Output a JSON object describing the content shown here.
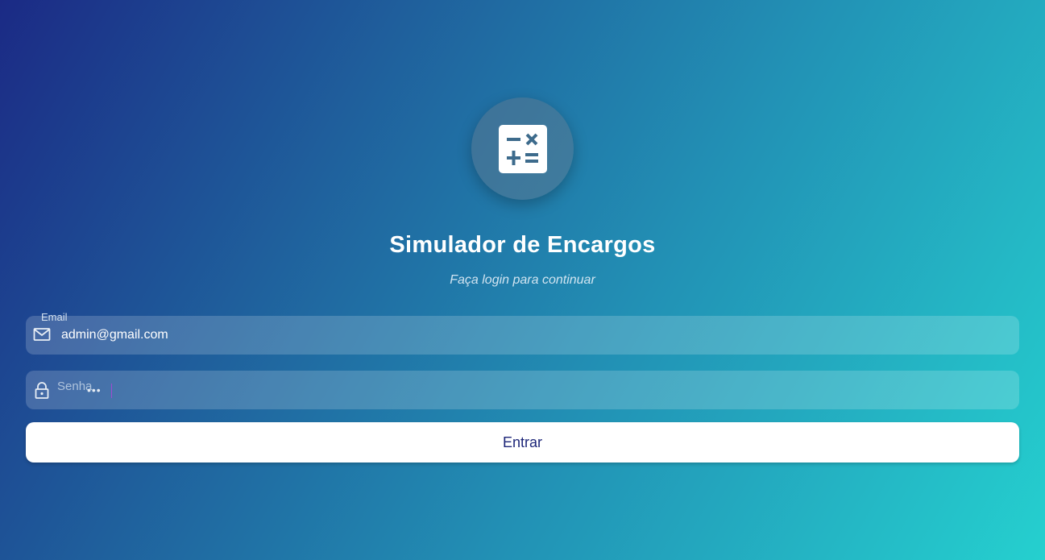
{
  "app": {
    "title": "Simulador de Encargos",
    "subtitle": "Faça login para continuar",
    "logo_icon": "calculator-icon"
  },
  "form": {
    "email": {
      "label": "Email",
      "value": "admin@gmail.com",
      "icon": "mail-icon"
    },
    "password": {
      "label": "Senha",
      "masked_value": "•••",
      "icon": "lock-icon"
    },
    "submit_label": "Entrar"
  },
  "colors": {
    "gradient_start": "#1b2a85",
    "gradient_end": "#25d0cf",
    "button_text": "#1c2578"
  }
}
